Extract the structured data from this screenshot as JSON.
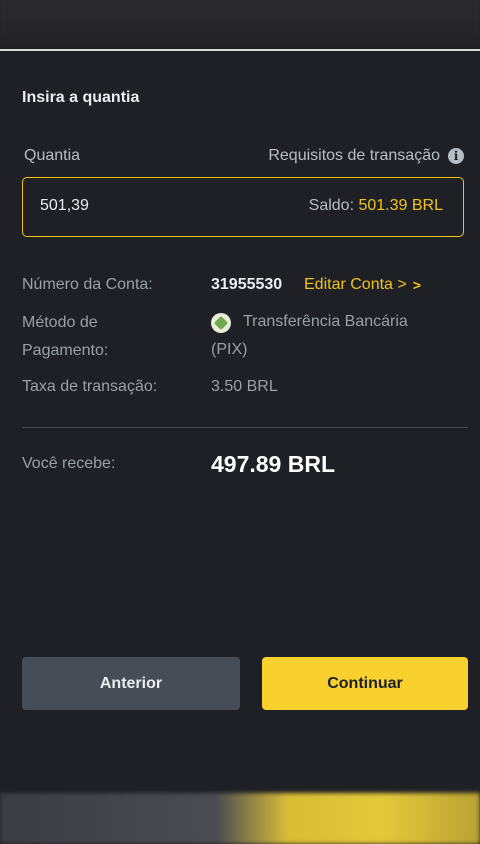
{
  "sheet": {
    "title": "Insira a quantia"
  },
  "amount": {
    "label": "Quantia",
    "requirements_label": "Requisitos de transação",
    "value": "501,39",
    "balance_label": "Saldo:",
    "balance_value": "501.39 BRL"
  },
  "details": {
    "account_label": "Número da Conta:",
    "account_number": "31955530",
    "edit_account_label": "Editar Conta >",
    "payment_method_label_line1": "Método de",
    "payment_method_label_line2": "Pagamento:",
    "payment_method_line1": "Transferência Bancária",
    "payment_method_line2": "(PIX)",
    "fee_label": "Taxa de transação:",
    "fee_value": "3.50 BRL"
  },
  "receive": {
    "label": "Você recebe:",
    "value": "497.89 BRL"
  },
  "actions": {
    "back_label": "Anterior",
    "continue_label": "Continuar"
  },
  "colors": {
    "accent": "#f8d12f",
    "background": "#1e2026",
    "secondary_button": "#474d57"
  },
  "icons": {
    "info": "info-icon",
    "chevron": "chevron-right-icon",
    "pix": "pix-icon"
  }
}
